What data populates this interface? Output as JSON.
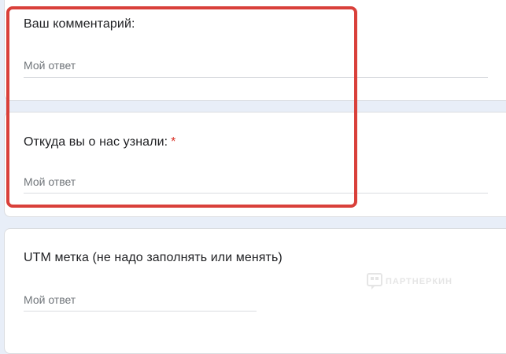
{
  "questions": [
    {
      "title": "Ваш комментарий:",
      "required": false,
      "placeholder": "Мой ответ"
    },
    {
      "title": "Откуда вы о нас узнали:",
      "required": true,
      "required_mark": "*",
      "placeholder": "Мой ответ"
    },
    {
      "title": "UTM метка (не надо заполнять или менять)",
      "required": false,
      "placeholder": "Мой ответ"
    }
  ],
  "watermark": {
    "text": "ПАРТНЕРКИН"
  },
  "colors": {
    "page_bg": "#e8eef8",
    "highlight": "#d9403a",
    "required": "#d93025"
  }
}
